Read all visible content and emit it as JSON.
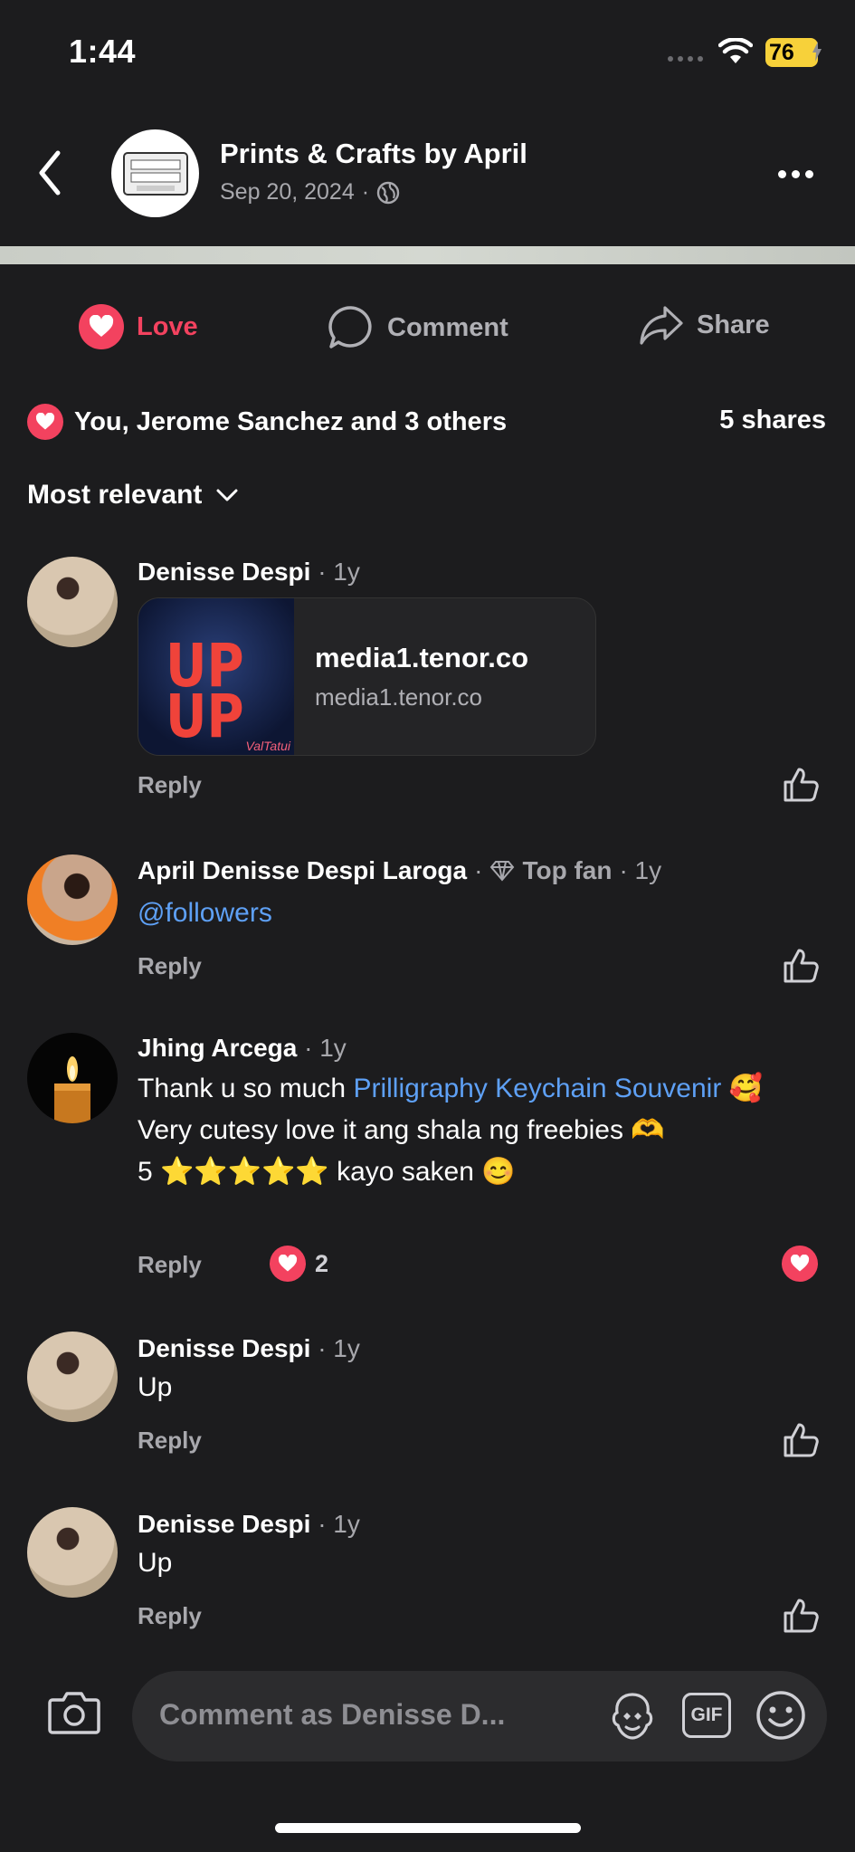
{
  "status_bar": {
    "time": "1:44",
    "battery": "76"
  },
  "header": {
    "page_name": "Prints & Crafts by April",
    "date": "Sep 20, 2024",
    "separator": "·"
  },
  "actions": {
    "love": "Love",
    "comment": "Comment",
    "share": "Share"
  },
  "engagement": {
    "reactions_text": "You, Jerome Sanchez and 3 others",
    "shares": "5 shares"
  },
  "sort": {
    "label": "Most relevant"
  },
  "reply_label": "Reply",
  "comments": [
    {
      "author": "Denisse Despi",
      "age": "· 1y",
      "link_card": {
        "thumb_line1": "UP",
        "thumb_line2": "UP",
        "thumb_signature": "ValTatui",
        "title": "media1.tenor.co",
        "subtitle": "media1.tenor.co"
      }
    },
    {
      "author": "April Denisse Despi Laroga",
      "badge": "· ",
      "badge_label": "Top fan",
      "age": "· 1y",
      "text": "@followers"
    },
    {
      "author": "Jhing Arcega",
      "age": "· 1y",
      "text_plain_1": "Thank u so much ",
      "text_link": "Prilligraphy Keychain Souvenir",
      "text_emoji_1": " 🥰",
      "text_line_2": "Very cutesy love it ang shala ng freebies 🫶",
      "text_line_3": "5 ⭐⭐⭐⭐⭐ kayo saken 😊",
      "reaction_count": "2"
    },
    {
      "author": "Denisse Despi",
      "age": "· 1y",
      "text": "Up"
    },
    {
      "author": "Denisse Despi",
      "age": "· 1y",
      "text": "Up"
    }
  ],
  "composer": {
    "placeholder": "Comment as Denisse D...",
    "gif_label": "GIF"
  },
  "colors": {
    "background": "#1c1c1e",
    "love": "#f3425f",
    "link": "#5ea0f5",
    "muted": "#a8a8ad"
  }
}
